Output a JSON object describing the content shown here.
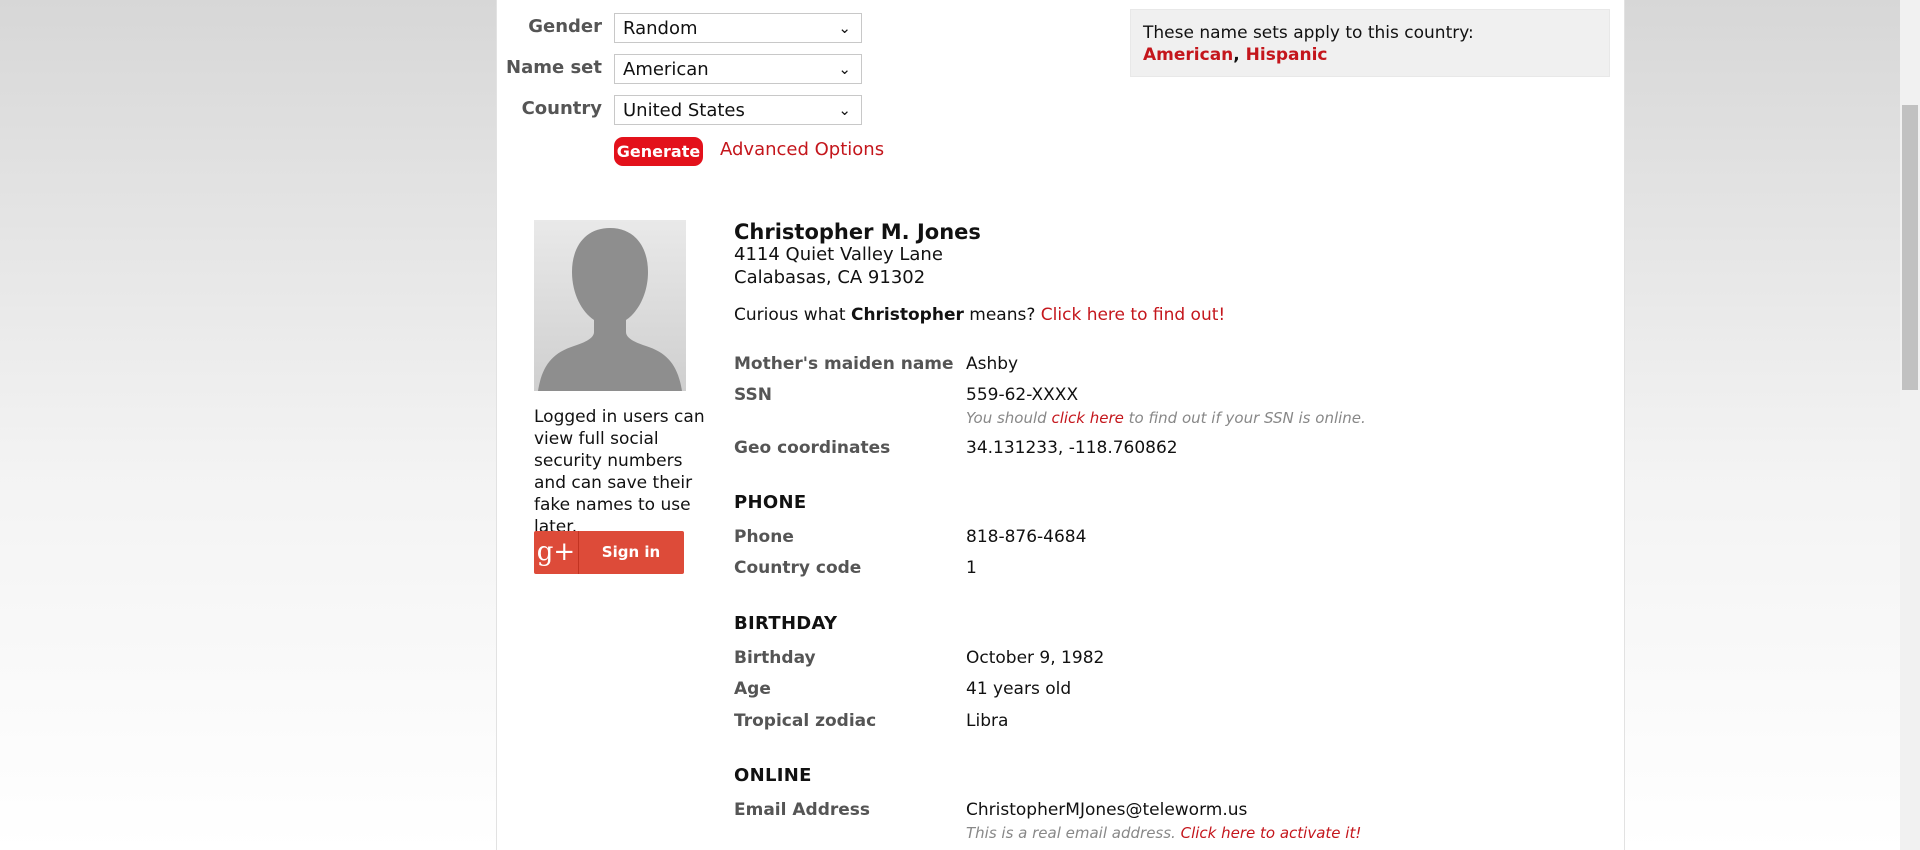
{
  "form": {
    "gender_label": "Gender",
    "gender_value": "Random",
    "nameset_label": "Name set",
    "nameset_value": "American",
    "country_label": "Country",
    "country_value": "United States",
    "generate_label": "Generate",
    "advanced_label": "Advanced Options"
  },
  "nameset_box": {
    "text": "These name sets apply to this country:",
    "set1": "American",
    "separator": ",",
    "set2": "Hispanic"
  },
  "left": {
    "login_text": "Logged in users can view full social security numbers and can save their fake names to use later.",
    "gplus_symbol": "g+",
    "signin_label": "Sign in"
  },
  "person": {
    "name": "Christopher M. Jones",
    "street": "4114 Quiet Valley Lane",
    "city": "Calabasas, CA 91302",
    "curious_prefix": "Curious what",
    "first_name": "Christopher",
    "curious_suffix": "means?",
    "curious_link": "Click here to find out!"
  },
  "details": {
    "maiden_label": "Mother's maiden name",
    "maiden_value": "Ashby",
    "ssn_label": "SSN",
    "ssn_value": "559-62-XXXX",
    "ssn_note_prefix": "You should",
    "ssn_note_link": "click here",
    "ssn_note_suffix": "to find out if your SSN is online.",
    "geo_label": "Geo coordinates",
    "geo_value": "34.131233, -118.760862"
  },
  "phone": {
    "heading": "PHONE",
    "phone_label": "Phone",
    "phone_value": "818-876-4684",
    "cc_label": "Country code",
    "cc_value": "1"
  },
  "birthday": {
    "heading": "BIRTHDAY",
    "bday_label": "Birthday",
    "bday_value": "October 9, 1982",
    "age_label": "Age",
    "age_value": "41 years old",
    "zodiac_label": "Tropical zodiac",
    "zodiac_value": "Libra"
  },
  "online": {
    "heading": "ONLINE",
    "email_label": "Email Address",
    "email_value": "ChristopherMJones@teleworm.us",
    "email_note_prefix": "This is a real email address.",
    "email_note_link": "Click here to activate it!"
  },
  "colors": {
    "accent": "#e3111b",
    "link": "#c4161c",
    "label_gray": "#555555"
  }
}
